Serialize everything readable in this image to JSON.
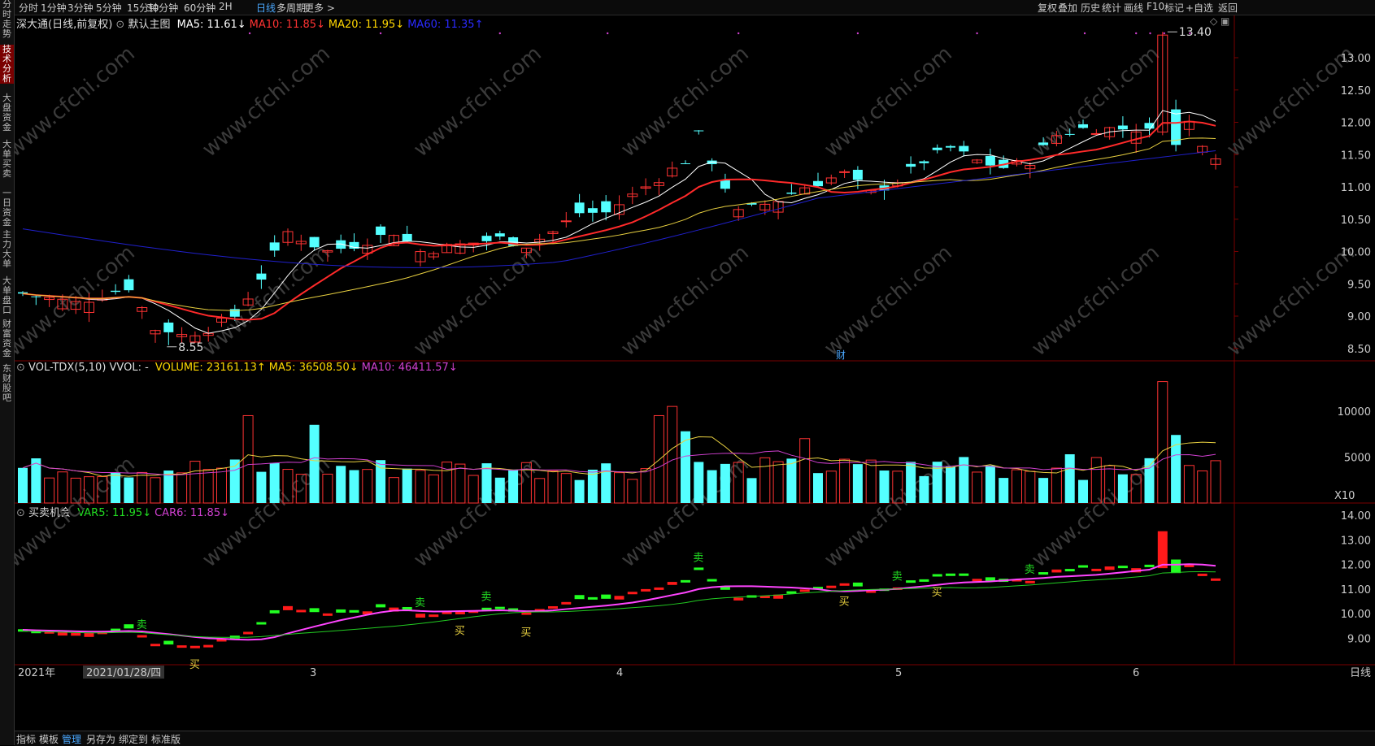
{
  "sidebar": {
    "tabs": [
      {
        "label": "分时走势",
        "active": false
      },
      {
        "label": "技术分析",
        "active": true
      },
      {
        "label": "大盘资金",
        "active": false
      },
      {
        "label": "大单买卖",
        "active": false
      },
      {
        "label": "一日资金",
        "active": false
      },
      {
        "label": "主力大单",
        "active": false
      },
      {
        "label": "大单盘口",
        "active": false
      },
      {
        "label": "财富资金",
        "active": false
      },
      {
        "label": "东财股吧",
        "active": false
      }
    ]
  },
  "toolbar": {
    "periods": [
      "分时",
      "1分钟",
      "3分钟",
      "5分钟",
      "15分钟",
      "30分钟",
      "60分钟",
      "2H",
      "日线",
      "多周期",
      "更多 >"
    ],
    "active_period": "日线",
    "right_items": [
      "复权",
      "叠加",
      "历史",
      "统计",
      "画线",
      "F10",
      "标记",
      "+自选",
      "返回"
    ]
  },
  "main_panel": {
    "stock_name": "深大通(日线,前复权)",
    "template": "默认主图",
    "indicators": [
      {
        "text": "MA5: 11.61↓",
        "color": "#ffffff"
      },
      {
        "text": "MA10: 11.85↓",
        "color": "#ff3333"
      },
      {
        "text": "MA20: 11.95↓",
        "color": "#ffd700"
      },
      {
        "text": "MA60: 11.35↑",
        "color": "#2a2aff"
      }
    ],
    "y_ticks": [
      "13.00",
      "12.50",
      "12.00",
      "11.50",
      "11.00",
      "10.50",
      "10.00",
      "9.50",
      "9.00",
      "8.50"
    ],
    "high_label": "13.40",
    "low_label": "8.55",
    "event_marker": "财"
  },
  "volume_panel": {
    "name": "VOL-TDX(5,10) VVOL: -",
    "indicators": [
      {
        "text": "VOLUME: 23161.13↑",
        "color": "#ffd700"
      },
      {
        "text": "MA5: 36508.50↓",
        "color": "#ffd700"
      },
      {
        "text": "MA10: 46411.57↓",
        "color": "#d040d0"
      }
    ],
    "y_ticks": [
      "10000",
      "5000"
    ],
    "unit": "X10"
  },
  "signal_panel": {
    "name": "买卖机会",
    "indicators": [
      {
        "text": "VAR5: 11.95↓",
        "color": "#22dd22"
      },
      {
        "text": "CAR6: 11.85↓",
        "color": "#d040d0"
      }
    ],
    "y_ticks": [
      "14.00",
      "13.00",
      "12.00",
      "11.00",
      "10.00",
      "9.00"
    ],
    "buy_label": "买",
    "sell_label": "卖"
  },
  "x_axis": {
    "labels": [
      "2021年",
      "2021/01/28/四",
      "3",
      "4",
      "5",
      "6"
    ],
    "period_label": "日线"
  },
  "bottom_tabs": [
    "指标",
    "模板",
    "管理",
    "另存为",
    "绑定到",
    "标准版"
  ],
  "watermark": "www.cfchi.com",
  "colors": {
    "up": "#ff3333",
    "down": "#54ffff",
    "ma5": "#ffffff",
    "ma10": "#ff2a2a",
    "ma20": "#e8d040",
    "ma60": "#2020cc"
  }
}
